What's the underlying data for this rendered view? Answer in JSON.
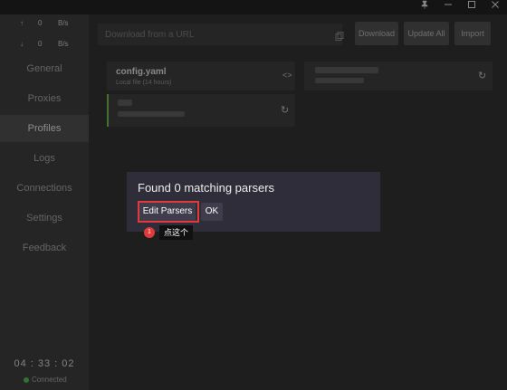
{
  "window": {
    "controls": [
      "pin-icon",
      "minimize-icon",
      "maximize-icon",
      "close-icon"
    ]
  },
  "sidebar": {
    "upload": {
      "arrow": "↑",
      "value": "0",
      "unit": "B/s"
    },
    "download": {
      "arrow": "↓",
      "value": "0",
      "unit": "B/s"
    },
    "items": [
      {
        "label": "General",
        "active": false
      },
      {
        "label": "Proxies",
        "active": false
      },
      {
        "label": "Profiles",
        "active": true
      },
      {
        "label": "Logs",
        "active": false
      },
      {
        "label": "Connections",
        "active": false
      },
      {
        "label": "Settings",
        "active": false
      },
      {
        "label": "Feedback",
        "active": false
      }
    ],
    "clock": "04 : 33 : 02",
    "status": "Connected"
  },
  "main": {
    "url_placeholder": "Download from a URL",
    "buttons": {
      "download": "Download",
      "update_all": "Update All",
      "import": "Import"
    },
    "profiles": [
      {
        "title": "config.yaml",
        "subtitle": "Local file (14 hours)"
      }
    ]
  },
  "dialog": {
    "title": "Found 0 matching parsers",
    "edit_parsers": "Edit Parsers",
    "ok": "OK"
  },
  "annotation": {
    "step": "1",
    "tip": "点这个"
  },
  "colors": {
    "accent_red": "#e03a3a",
    "connected_green": "#4caf50"
  }
}
